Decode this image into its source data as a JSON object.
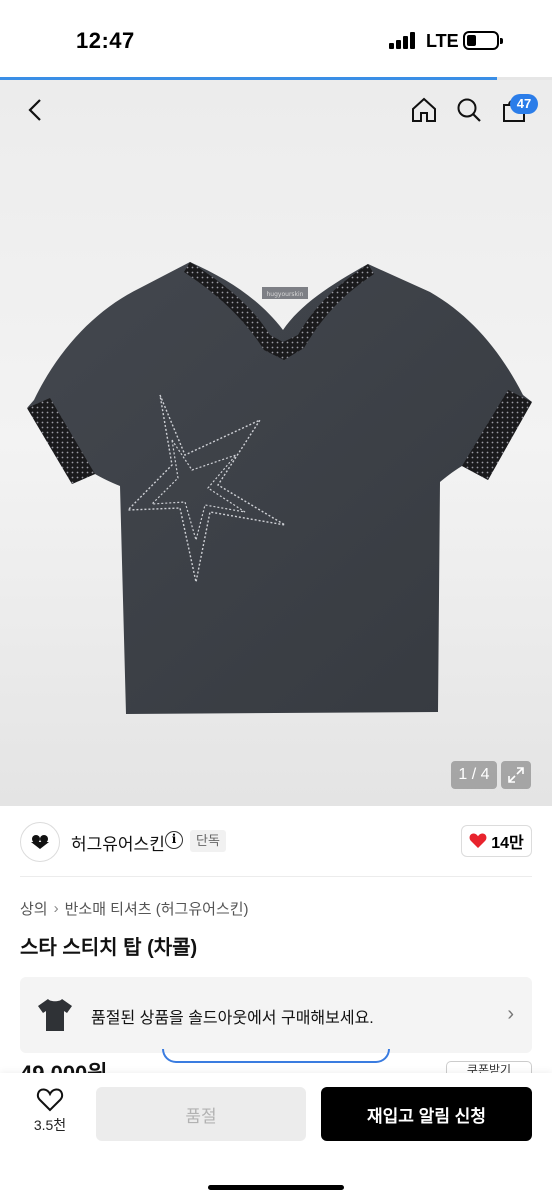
{
  "status": {
    "time": "12:47",
    "network": "LTE"
  },
  "page_load_progress": 0.9,
  "header": {
    "cart_count": "47"
  },
  "gallery": {
    "counter": "1 / 4",
    "tag_label": "hugyourskin"
  },
  "brand": {
    "name": "허그유어스킨",
    "info_glyph": "i",
    "exclusive_badge": "단독",
    "likes": "14만"
  },
  "breadcrumb": {
    "category": "상의",
    "separator": "›",
    "subcategory": "반소매 티셔츠 (허그유어스킨)"
  },
  "product": {
    "title": "스타 스티치 탑 (차콜)",
    "price": "49,000원"
  },
  "soldout_banner": {
    "text": "품절된 상품을 솔드아웃에서 구매해보세요.",
    "chevron": "›"
  },
  "coupon": {
    "label": "쿠폰받기"
  },
  "bottom_bar": {
    "wish_count": "3.5천",
    "soldout_label": "품절",
    "restock_label": "재입고 알림 신청"
  },
  "colors": {
    "accent_blue": "#2b7de9",
    "heart_red": "#e8232d",
    "cta_black": "#000000",
    "shirt_charcoal": "#3c4047"
  }
}
